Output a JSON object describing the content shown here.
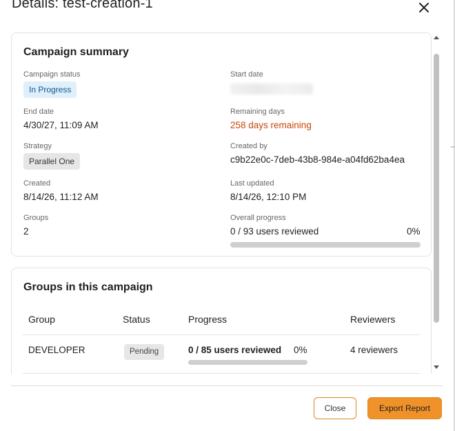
{
  "modal": {
    "title": "Details: test-creation-1",
    "close_icon": "close-icon"
  },
  "summary": {
    "title": "Campaign summary",
    "campaign_status_label": "Campaign status",
    "campaign_status_value": "In Progress",
    "start_date_label": "Start date",
    "end_date_label": "End date",
    "end_date_value": "4/30/27, 11:09 AM",
    "remaining_days_label": "Remaining days",
    "remaining_days_value": "258 days remaining",
    "strategy_label": "Strategy",
    "strategy_value": "Parallel One",
    "created_by_label": "Created by",
    "created_by_value": "c9b22e0c-7deb-43b8-984e-a04fd62ba4ea",
    "created_label": "Created",
    "created_value": "8/14/26, 11:12 AM",
    "last_updated_label": "Last updated",
    "last_updated_value": "8/14/26, 12:10 PM",
    "groups_label": "Groups",
    "groups_value": "2",
    "overall_progress_label": "Overall progress",
    "overall_progress_text": "0 / 93 users reviewed",
    "overall_progress_percent": "0%",
    "overall_progress_fraction": 0.0
  },
  "groups_section": {
    "title": "Groups in this campaign",
    "columns": [
      "Group",
      "Status",
      "Progress",
      "Reviewers"
    ],
    "rows": [
      {
        "group": "DEVELOPER",
        "status": "Pending",
        "progress_text": "0 / 85 users reviewed",
        "progress_percent": "0%",
        "progress_fraction": 0.0,
        "reviewers": "4 reviewers"
      }
    ]
  },
  "footer": {
    "close_label": "Close",
    "export_label": "Export Report"
  },
  "colors": {
    "accent": "#f0922a",
    "remaining_text": "#c9460a",
    "status_badge_bg": "#dff0fb",
    "pending_badge_bg": "#e6e6e6"
  }
}
